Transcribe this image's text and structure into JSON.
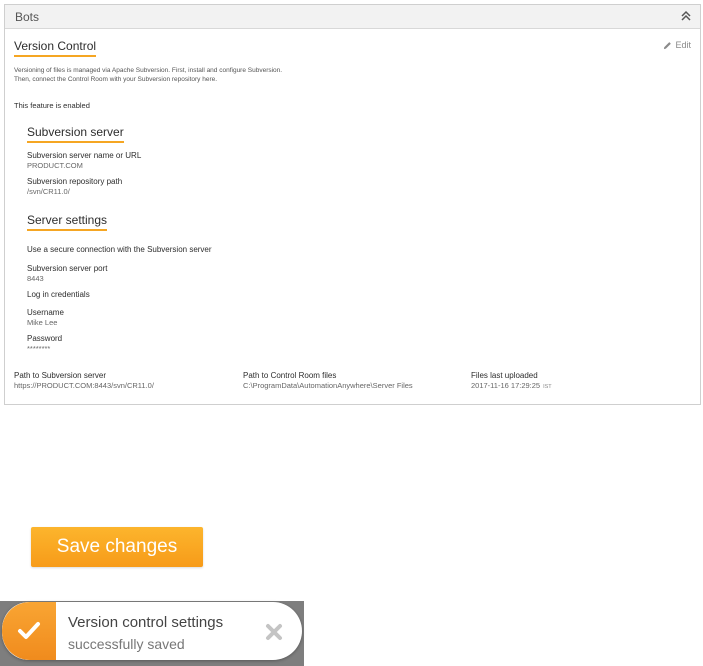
{
  "panel": {
    "title": "Bots"
  },
  "version_control": {
    "title": "Version Control",
    "edit_label": "Edit",
    "description_line1": "Versioning of files is managed via Apache Subversion. First, install and configure Subversion.",
    "description_line2": "Then, connect the Control Room with your Subversion repository here.",
    "status": "This feature is enabled"
  },
  "subversion_server": {
    "title": "Subversion server",
    "name_label": "Subversion server name or URL",
    "name_value": "PRODUCT.COM",
    "repo_label": "Subversion repository path",
    "repo_value": "/svn/CR11.0/"
  },
  "server_settings": {
    "title": "Server settings",
    "secure_connection": "Use a secure connection with the Subversion server",
    "port_label": "Subversion server port",
    "port_value": "8443",
    "credentials_label": "Log in credentials",
    "username_label": "Username",
    "username_value": "Mike Lee",
    "password_label": "Password",
    "password_value": "********"
  },
  "paths": {
    "svn_label": "Path to Subversion server",
    "svn_value": "https://PRODUCT.COM:8443/svn/CR11.0/",
    "cr_label": "Path to Control Room files",
    "cr_value": "C:\\ProgramData\\AutomationAnywhere\\Server Files",
    "uploaded_label": "Files last uploaded",
    "uploaded_value": "2017-11-16 17:29:25",
    "uploaded_tz": "IST"
  },
  "save_button": {
    "label": "Save changes"
  },
  "toast": {
    "line1": "Version control settings",
    "line2": "successfully saved"
  },
  "colors": {
    "accent": "#f5a623",
    "button": "#f9a825",
    "toast_check": "#f39a28"
  },
  "icons": {
    "collapse": "double-chevron-up-icon",
    "edit": "pencil-icon",
    "check": "checkmark-icon",
    "close": "close-icon"
  }
}
